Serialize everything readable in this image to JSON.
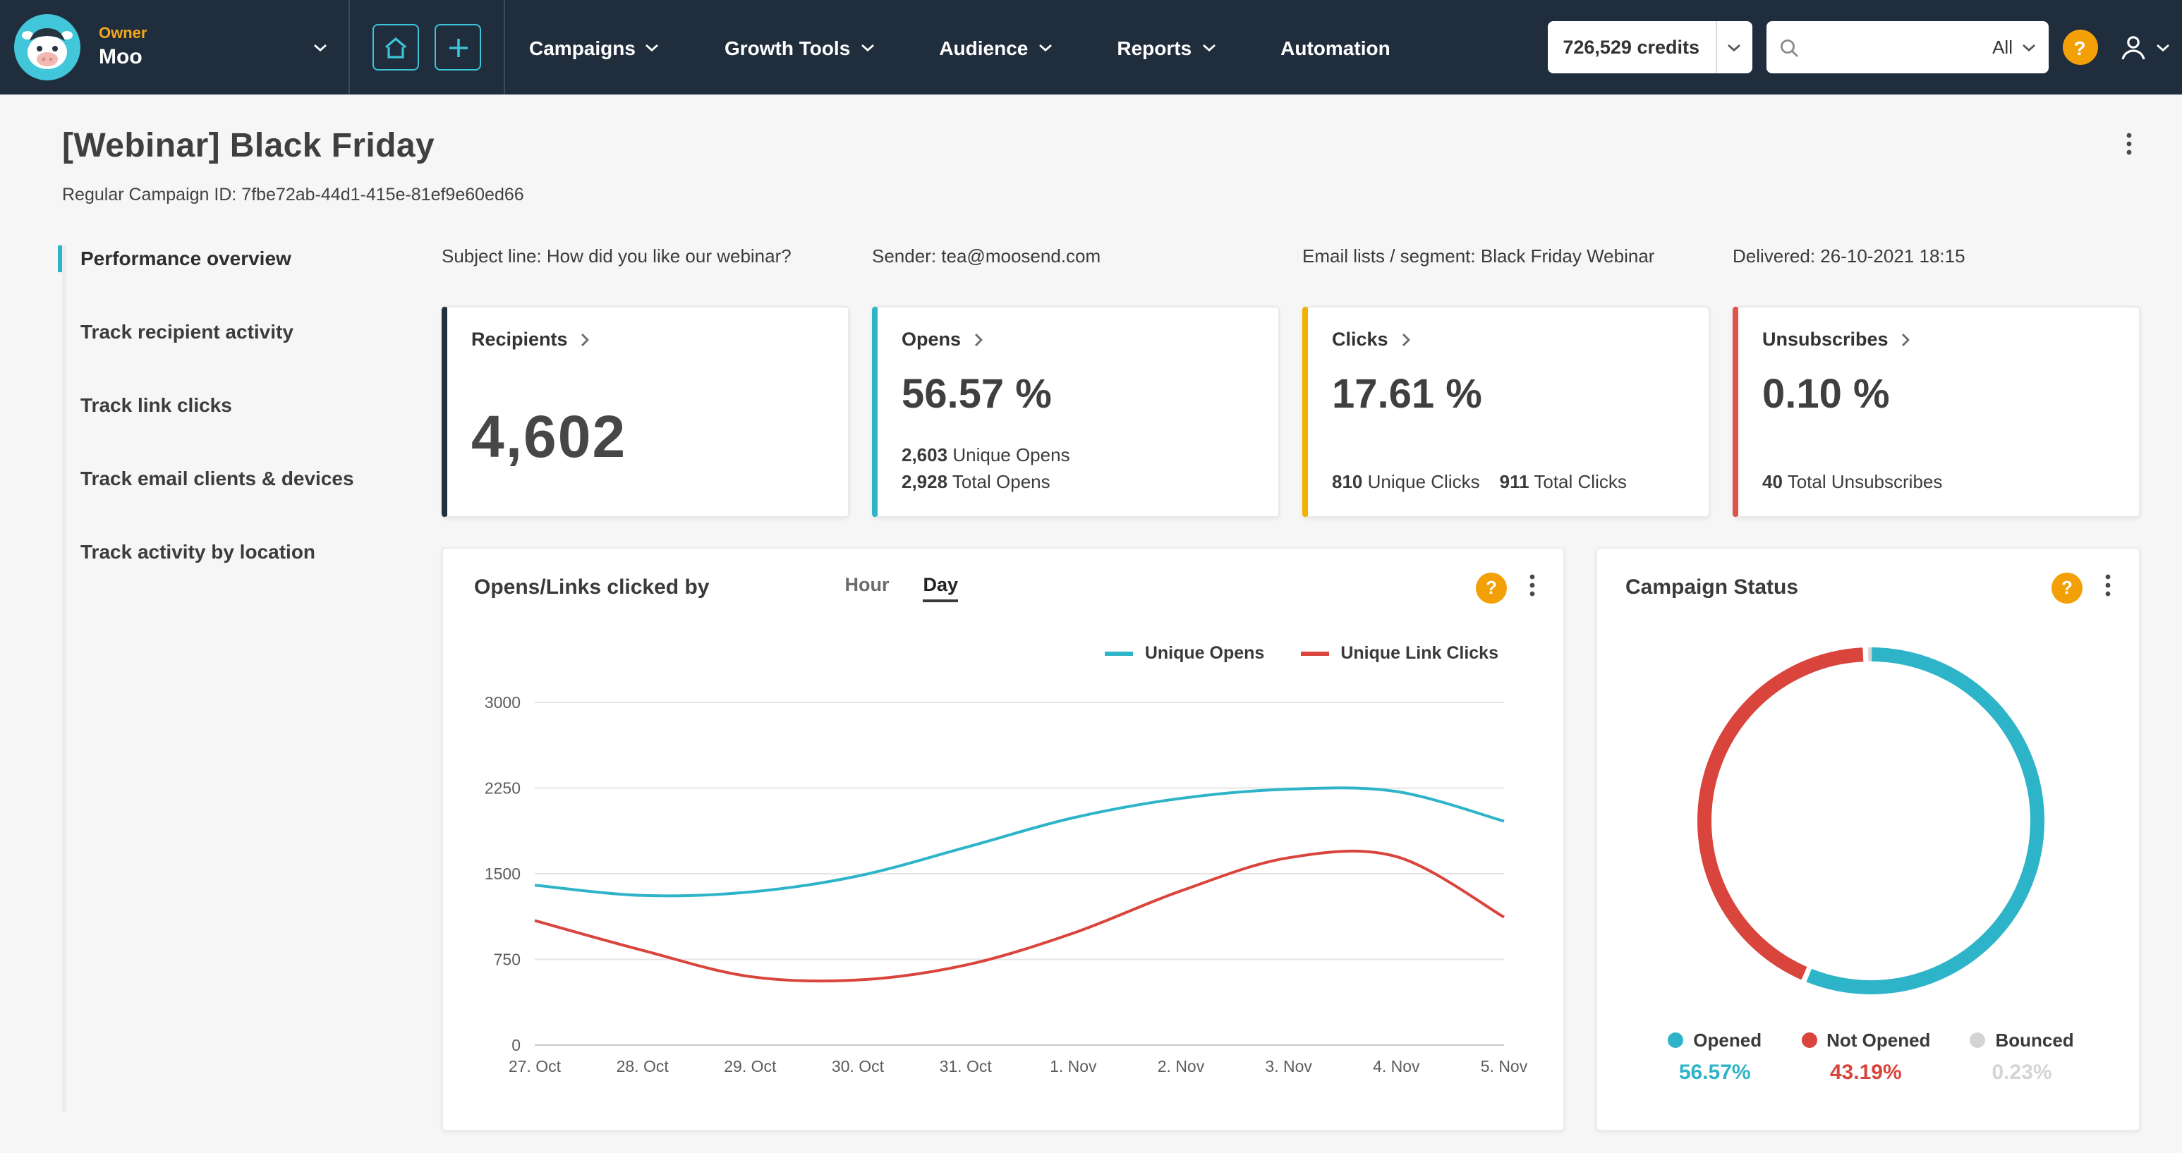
{
  "navbar": {
    "owner_label": "Owner",
    "owner_name": "Moo",
    "nav_items": [
      "Campaigns",
      "Growth Tools",
      "Audience",
      "Reports",
      "Automation"
    ],
    "credits": "726,529 credits",
    "search_scope": "All",
    "help_glyph": "?"
  },
  "page": {
    "title": "[Webinar] Black Friday",
    "campaign_id": "Regular Campaign ID: 7fbe72ab-44d1-415e-81ef9e60ed66"
  },
  "side_menu": [
    "Performance overview",
    "Track recipient activity",
    "Track link clicks",
    "Track email clients & devices",
    "Track activity by location"
  ],
  "meta": {
    "subject": "Subject line: How did you like our webinar?",
    "sender": "Sender: tea@moosend.com",
    "lists": "Email lists / segment: Black Friday Webinar",
    "delivered": "Delivered: 26-10-2021 18:15"
  },
  "cards": {
    "recipients": {
      "title": "Recipients",
      "value": "4,602",
      "accent": "#22313f"
    },
    "opens": {
      "title": "Opens",
      "rate": "56.57 %",
      "unique_value": "2,603",
      "unique_label": "Unique Opens",
      "total_value": "2,928",
      "total_label": "Total Opens",
      "accent": "#2eb4c8"
    },
    "clicks": {
      "title": "Clicks",
      "rate": "17.61 %",
      "unique_value": "810",
      "unique_label": "Unique Clicks",
      "total_value": "911",
      "total_label": "Total Clicks",
      "accent": "#f0b400"
    },
    "unsubscribes": {
      "title": "Unsubscribes",
      "rate": "0.10 %",
      "total_value": "40",
      "total_label": "Total Unsubscribes",
      "accent": "#e0534a"
    }
  },
  "chart_data": [
    {
      "type": "line",
      "title": "Opens/Links clicked by",
      "tabs": [
        "Hour",
        "Day"
      ],
      "active_tab": "Day",
      "x": [
        "27. Oct",
        "28. Oct",
        "29. Oct",
        "30. Oct",
        "31. Oct",
        "1. Nov",
        "2. Nov",
        "3. Nov",
        "4. Nov",
        "5. Nov"
      ],
      "series": [
        {
          "name": "Unique Opens",
          "color": "#2eb4c8",
          "values": [
            1400,
            1310,
            1340,
            1480,
            1730,
            1990,
            2160,
            2240,
            2220,
            1960
          ]
        },
        {
          "name": "Unique Link Clicks",
          "color": "#d9443c",
          "values": [
            1090,
            830,
            600,
            570,
            700,
            980,
            1350,
            1640,
            1650,
            1120
          ]
        }
      ],
      "ylim": [
        0,
        3000
      ],
      "yticks": [
        0,
        750,
        1500,
        2250,
        3000
      ],
      "grid": true,
      "legend_position": "top-right"
    },
    {
      "type": "donut",
      "title": "Campaign Status",
      "slices": [
        {
          "label": "Opened",
          "value": 56.57,
          "display": "56.57%",
          "color": "#2eb4c8"
        },
        {
          "label": "Not Opened",
          "value": 43.19,
          "display": "43.19%",
          "color": "#d9443c"
        },
        {
          "label": "Bounced",
          "value": 0.23,
          "display": "0.23%",
          "color": "#d4d4d4"
        }
      ]
    }
  ]
}
